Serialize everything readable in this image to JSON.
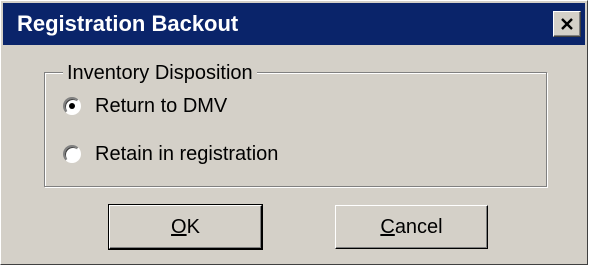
{
  "window": {
    "title": "Registration Backout",
    "close_icon": "close-icon"
  },
  "inventory_group": {
    "legend": "Inventory Disposition",
    "options": [
      {
        "label": "Return to DMV",
        "selected": true
      },
      {
        "label": "Retain in registration",
        "selected": false
      }
    ]
  },
  "buttons": {
    "ok": {
      "accel": "O",
      "rest": "K"
    },
    "cancel": {
      "accel": "C",
      "rest": "ancel"
    }
  },
  "colors": {
    "titlebar": "#0a246a",
    "face": "#d4d0c8"
  }
}
